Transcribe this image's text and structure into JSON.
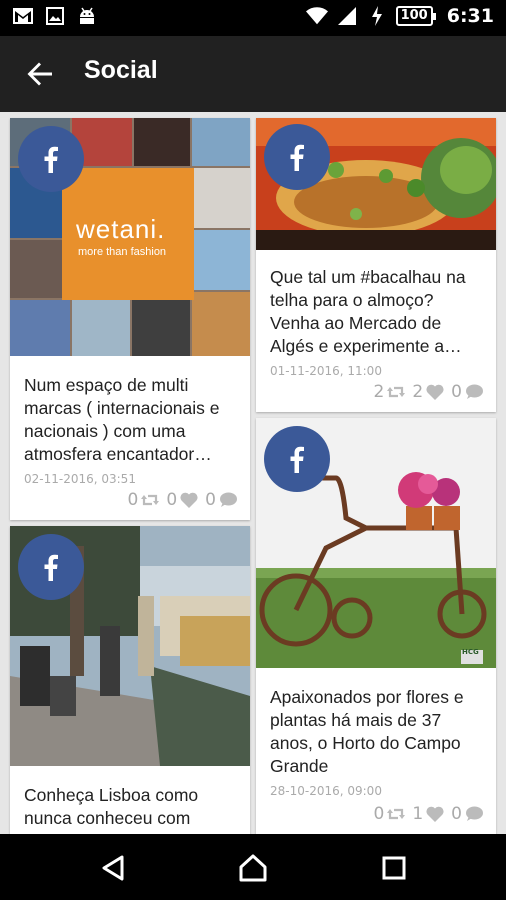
{
  "status_bar": {
    "battery": "100",
    "time": "6:31"
  },
  "app_bar": {
    "title": "Social"
  },
  "posts": [
    {
      "image_logo_main": "wetani.",
      "image_logo_sub": "more than fashion",
      "text": "Num espaço de multi marcas ( internacionais e nacionais ) com uma atmosfera encantador…",
      "date": "02-11-2016, 03:51",
      "shares": "0",
      "likes": "0",
      "comments": "0"
    },
    {
      "text": "Que tal um #bacalhau na telha para o almoço? Venha ao Mercado de Algés e experimente a…",
      "date": "01-11-2016, 11:00",
      "shares": "2",
      "likes": "2",
      "comments": "0"
    },
    {
      "text": "Conheça Lisboa como nunca conheceu com"
    },
    {
      "image_logo": "HCG",
      "text": "Apaixonados por flores e plantas há mais de 37 anos, o Horto do Campo Grande",
      "date": "28-10-2016, 09:00",
      "shares": "0",
      "likes": "1",
      "comments": "0"
    }
  ],
  "colors": {
    "facebook_blue": "#3b5998",
    "app_bar": "#212121",
    "stats_gray": "#aaaaaa"
  }
}
